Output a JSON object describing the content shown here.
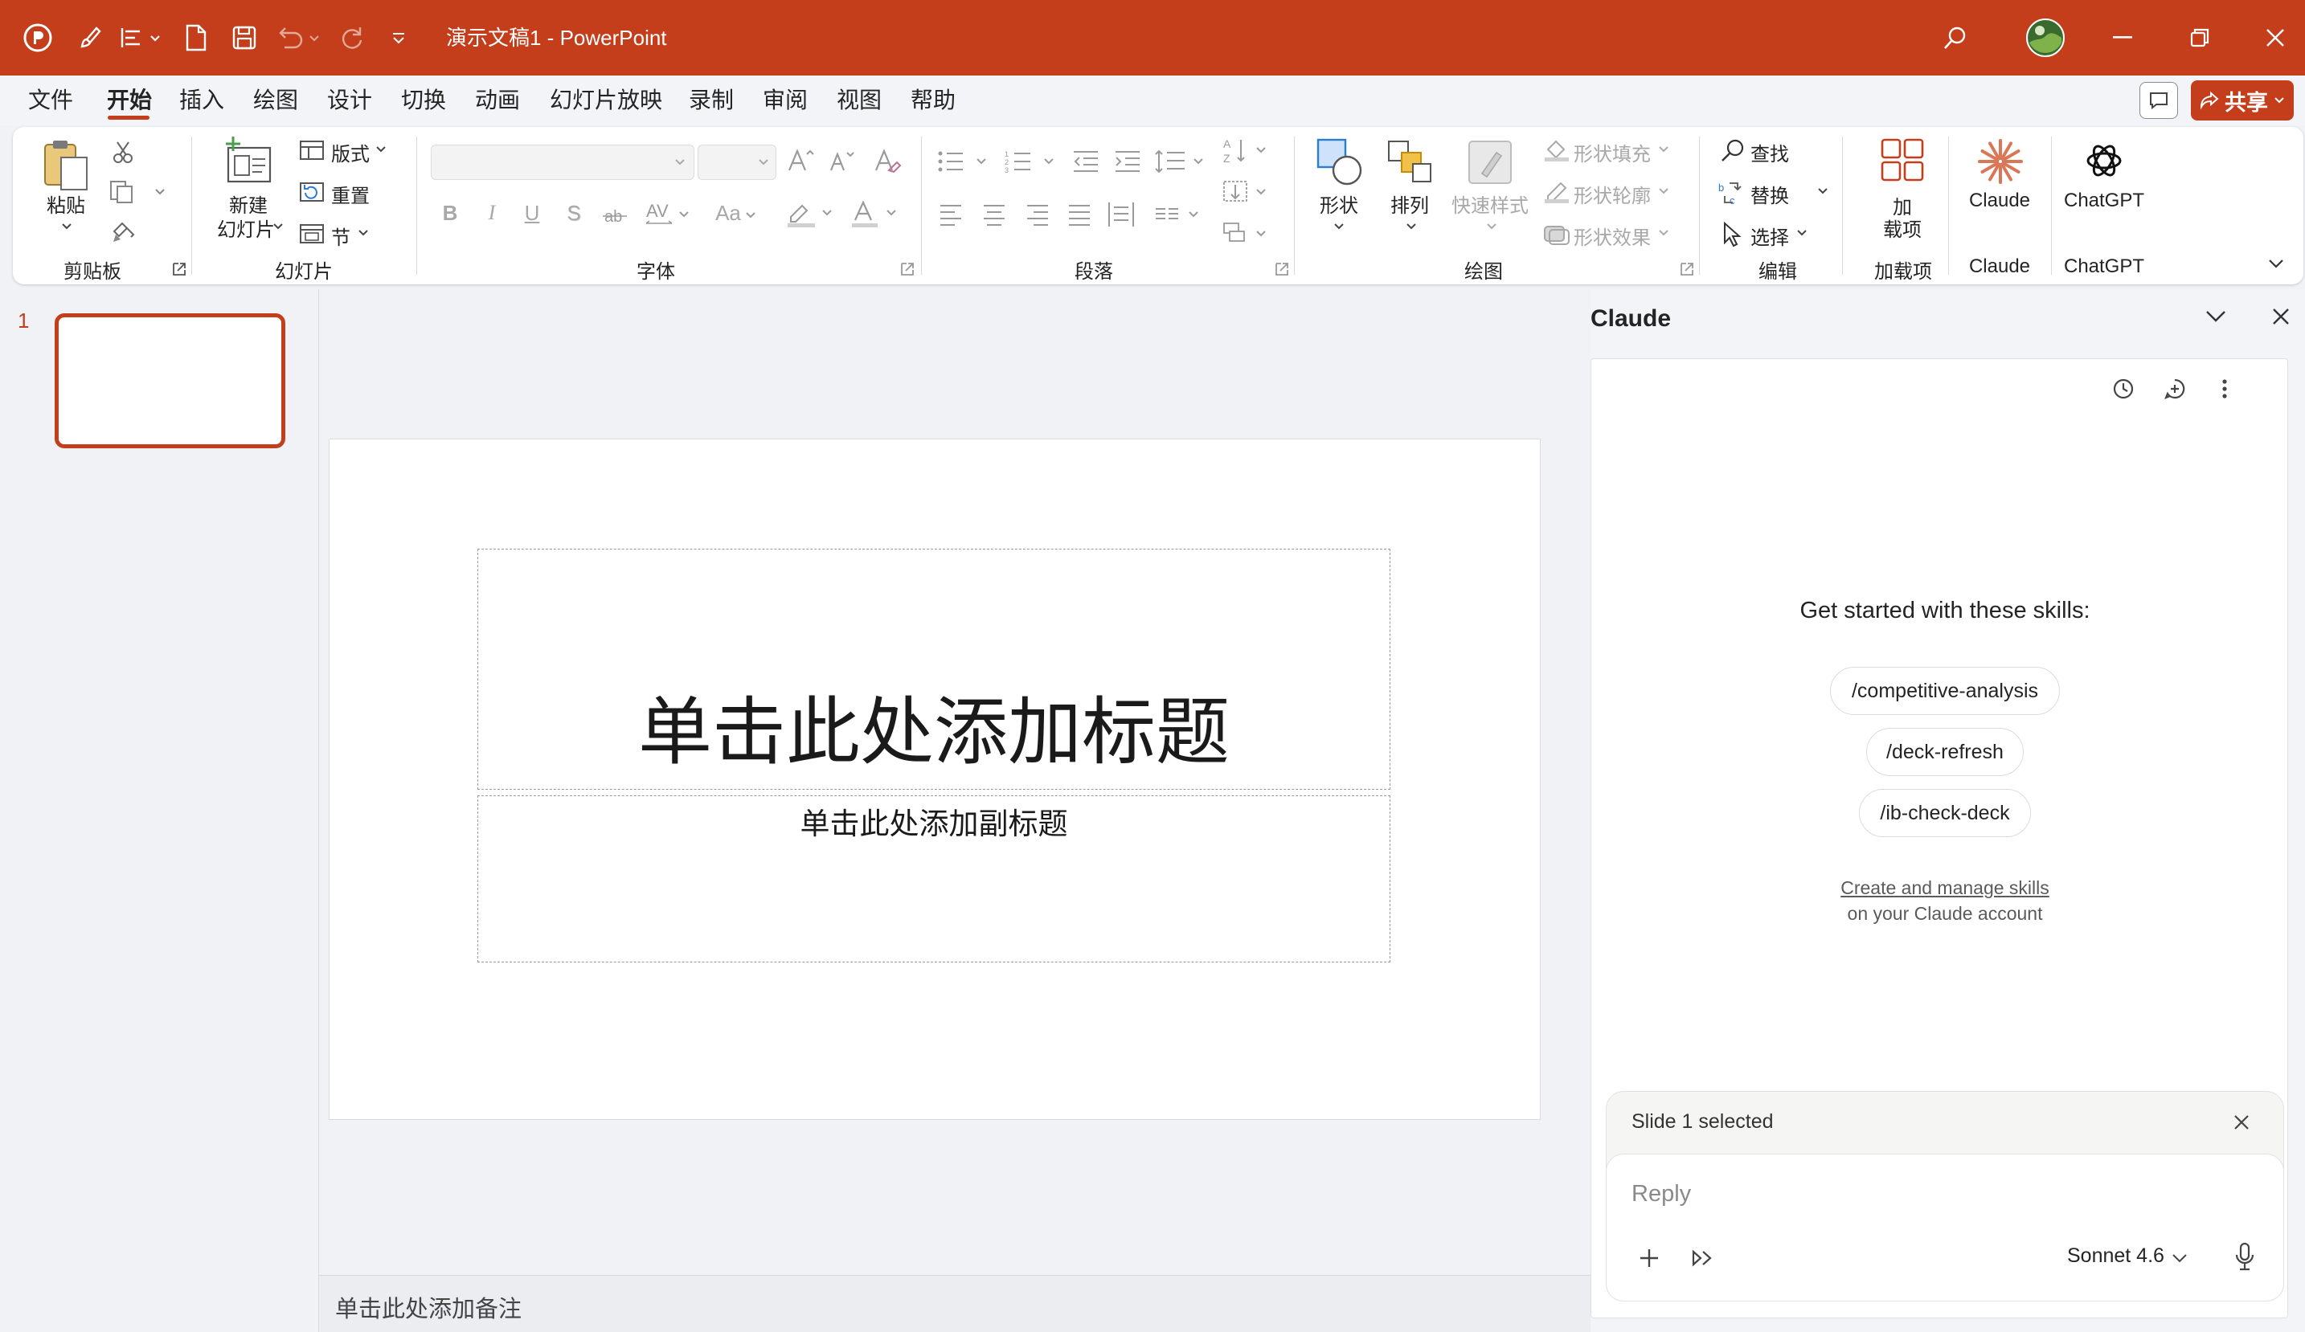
{
  "app": {
    "doc_title": "演示文稿1  -  PowerPoint",
    "accent": "#c43e1c"
  },
  "menu": {
    "tabs": [
      "文件",
      "开始",
      "插入",
      "绘图",
      "设计",
      "切换",
      "动画",
      "幻灯片放映",
      "录制",
      "审阅",
      "视图",
      "帮助"
    ],
    "active_tab": "开始",
    "share_label": "共享"
  },
  "ribbon": {
    "clipboard": {
      "paste": "粘贴",
      "group": "剪贴板"
    },
    "slides": {
      "new_slide_1": "新建",
      "new_slide_2": "幻灯片",
      "layout": "版式",
      "reset": "重置",
      "section": "节",
      "group": "幻灯片"
    },
    "font": {
      "group": "字体",
      "bold": "B",
      "italic": "I",
      "underline": "U",
      "strike": "S",
      "case": "Aa"
    },
    "paragraph": {
      "group": "段落"
    },
    "drawing": {
      "shapes": "形状",
      "arrange": "排列",
      "quick_styles": "快速样式",
      "fill": "形状填充",
      "outline": "形状轮廓",
      "effects": "形状效果",
      "group": "绘图"
    },
    "editing": {
      "find": "查找",
      "replace": "替换",
      "select": "选择",
      "group": "编辑"
    },
    "addins": {
      "label_1": "加",
      "label_2": "载项",
      "group": "加载项"
    },
    "claude": {
      "label": "Claude",
      "group": "Claude"
    },
    "chatgpt": {
      "label": "ChatGPT",
      "group": "ChatGPT"
    }
  },
  "slides_panel": {
    "slide_number": "1"
  },
  "slide": {
    "title_placeholder": "单击此处添加标题",
    "subtitle_placeholder": "单击此处添加副标题"
  },
  "notes": {
    "placeholder": "单击此处添加备注"
  },
  "pane": {
    "title": "Claude",
    "intro": "Get started with these skills:",
    "skills": [
      "/competitive-analysis",
      "/deck-refresh",
      "/ib-check-deck"
    ],
    "manage_link": "Create and manage skills",
    "manage_sub": "on your Claude account",
    "selection_status": "Slide 1 selected",
    "reply_placeholder": "Reply",
    "model": "Sonnet 4.6"
  }
}
